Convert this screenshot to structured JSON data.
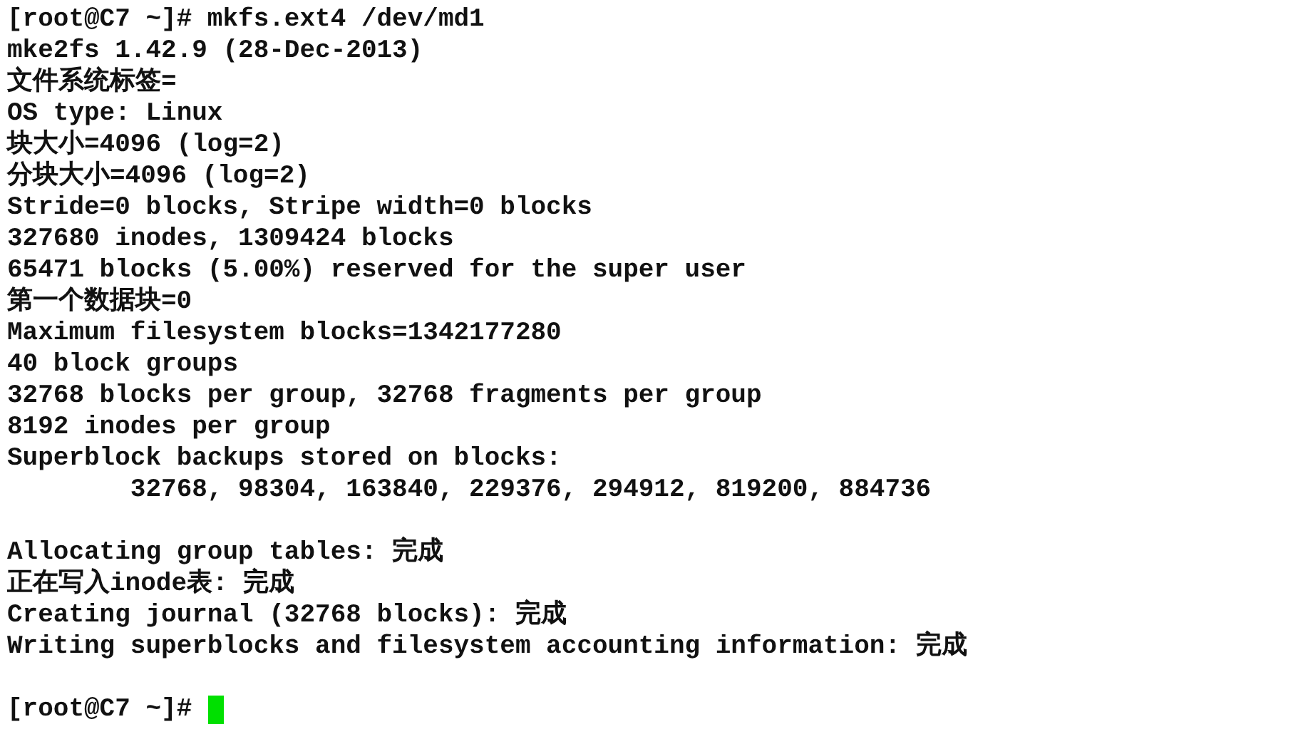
{
  "terminal": {
    "lines": [
      {
        "kind": "text",
        "text": "[root@C7 ~]# mkfs.ext4 /dev/md1"
      },
      {
        "kind": "text",
        "text": "mke2fs 1.42.9 (28-Dec-2013)"
      },
      {
        "kind": "text",
        "text": "文件系统标签="
      },
      {
        "kind": "text",
        "text": "OS type: Linux"
      },
      {
        "kind": "text",
        "text": "块大小=4096 (log=2)"
      },
      {
        "kind": "text",
        "text": "分块大小=4096 (log=2)"
      },
      {
        "kind": "text",
        "text": "Stride=0 blocks, Stripe width=0 blocks"
      },
      {
        "kind": "text",
        "text": "327680 inodes, 1309424 blocks"
      },
      {
        "kind": "text",
        "text": "65471 blocks (5.00%) reserved for the super user"
      },
      {
        "kind": "text",
        "text": "第一个数据块=0"
      },
      {
        "kind": "text",
        "text": "Maximum filesystem blocks=1342177280"
      },
      {
        "kind": "text",
        "text": "40 block groups"
      },
      {
        "kind": "text",
        "text": "32768 blocks per group, 32768 fragments per group"
      },
      {
        "kind": "text",
        "text": "8192 inodes per group"
      },
      {
        "kind": "text",
        "text": "Superblock backups stored on blocks:"
      },
      {
        "kind": "text",
        "text": "        32768, 98304, 163840, 229376, 294912, 819200, 884736"
      },
      {
        "kind": "blank"
      },
      {
        "kind": "text",
        "text": "Allocating group tables: 完成"
      },
      {
        "kind": "text",
        "text": "正在写入inode表: 完成"
      },
      {
        "kind": "text",
        "text": "Creating journal (32768 blocks): 完成"
      },
      {
        "kind": "text",
        "text": "Writing superblocks and filesystem accounting information: 完成"
      },
      {
        "kind": "blank"
      },
      {
        "kind": "prompt",
        "text": "[root@C7 ~]#"
      }
    ]
  }
}
